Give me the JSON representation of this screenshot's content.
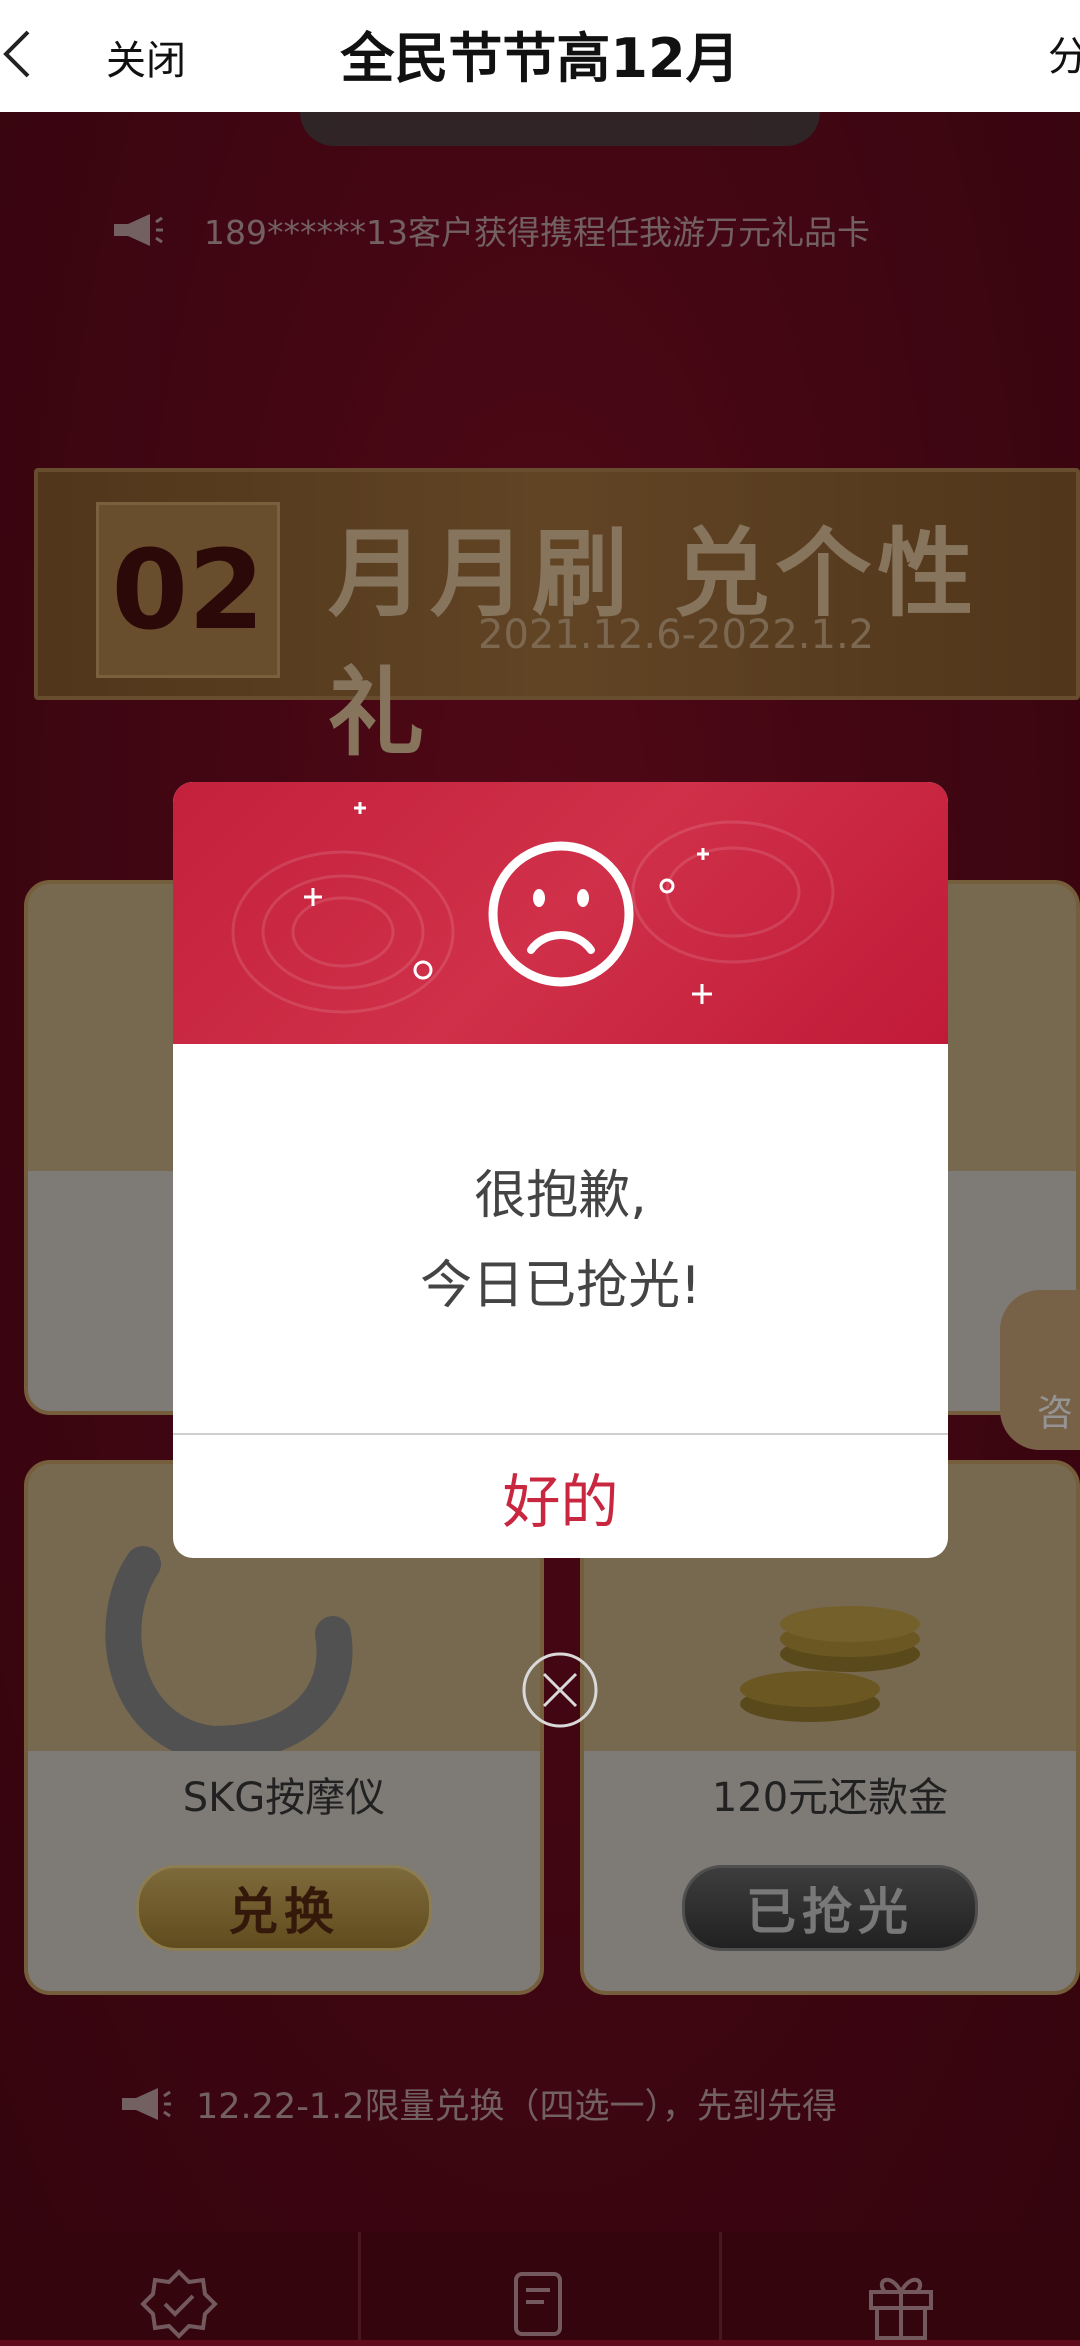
{
  "topbar": {
    "close_label": "关闭",
    "title": "全民节节高12月",
    "share_label": "分"
  },
  "ticker": {
    "text": "189******13客户获得携程任我游万元礼品卡"
  },
  "banner": {
    "number": "02",
    "title": "月月刷 兑个性礼",
    "date_range": "2021.12.6-2022.1.2"
  },
  "cards": [
    {
      "name": "SKG按摩仪",
      "button": "兑换",
      "status": "available"
    },
    {
      "name": "120元还款金",
      "button": "已抢光",
      "status": "sold-out"
    }
  ],
  "footer_note": "12.22-1.2限量兑换（四选一），先到先得",
  "consult_label": "咨",
  "dialog": {
    "line1": "很抱歉,",
    "line2": "今日已抢光!",
    "ok_label": "好的"
  },
  "colors": {
    "accent_red": "#c8273f",
    "page_bg": "#6d0b1f",
    "gold": "#c9a267"
  }
}
